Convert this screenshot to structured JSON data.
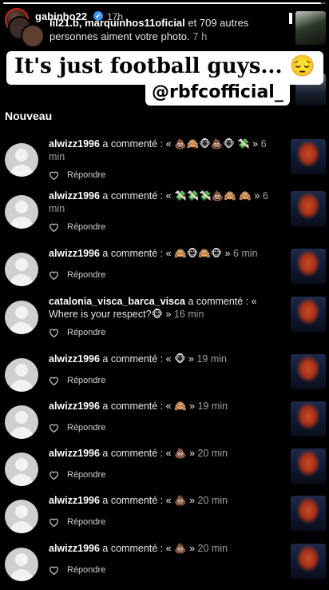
{
  "story": {
    "progress": 0.985,
    "username": "gabinho22",
    "time": "17h",
    "verified_glyph": "✔",
    "close_glyph": "✕"
  },
  "likes": {
    "users": "lil21.b, marquinhos11oficial",
    "rest": "et 709 autres personnes aiment votre photo.",
    "time": "7 h"
  },
  "overlay": {
    "caption": "It's just football guys... 😔",
    "mention": "@rbfcofficial_"
  },
  "section_title": "Nouveau",
  "reply_label": "Répondre",
  "commented_text": "a commenté :",
  "notifications": [
    {
      "user": "alwizz1996",
      "text": "« 💩🙈🐵💩🐵 💸 »",
      "time": "6 min"
    },
    {
      "user": "alwizz1996",
      "text": "« 💸💸💸💩🙈 🙈 »",
      "time": "6 min"
    },
    {
      "user": "alwizz1996",
      "text": "« 🙈🐵🙈🐵 »",
      "time": "6 min"
    },
    {
      "user": "catalonia_visca_barca_visca",
      "text": "« Where is your respect?🐵 »",
      "time": "16 min"
    },
    {
      "user": "alwizz1996",
      "text": "« 🐵 »",
      "time": "19 min"
    },
    {
      "user": "alwizz1996",
      "text": "« 🙈 »",
      "time": "19 min"
    },
    {
      "user": "alwizz1996",
      "text": "« 💩 »",
      "time": "20 min"
    },
    {
      "user": "alwizz1996",
      "text": "« 💩 »",
      "time": "20 min"
    },
    {
      "user": "alwizz1996",
      "text": "« 💩 »",
      "time": "20 min"
    }
  ]
}
